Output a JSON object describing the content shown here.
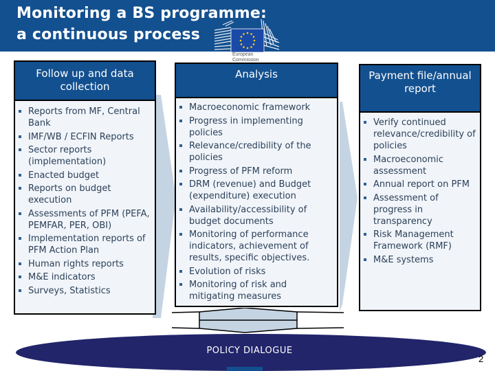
{
  "slide": {
    "title_lines": [
      "Monitoring a BS programme:",
      "a continuous process"
    ],
    "logo_caption": [
      "European",
      "Commission"
    ],
    "page_number": "2"
  },
  "columns": [
    {
      "heading": "Follow up and data collection",
      "items": [
        "Reports from MF, Central Bank",
        "IMF/WB / ECFIN Reports",
        "Sector reports (implementation)",
        "Enacted budget",
        "Reports on budget execution",
        "Assessments of PFM (PEFA, PEMFAR, PER, OBI)",
        "Implementation reports of PFM Action Plan",
        "Human rights reports",
        "M&E indicators",
        "Surveys, Statistics"
      ]
    },
    {
      "heading": "Analysis",
      "items": [
        "Macroeconomic framework",
        "Progress in implementing policies",
        "Relevance/credibility of the policies",
        "Progress of PFM reform",
        "DRM (revenue) and Budget (expenditure) execution",
        "Availability/accessibility of budget documents",
        "Monitoring of performance indicators, achievement of results,  specific objectives.",
        "Evolution of risks",
        "Monitoring of risk and mitigating measures"
      ]
    },
    {
      "heading": "Payment file/annual report",
      "items": [
        "Verify continued relevance/credibility of policies",
        "Macroeconomic assessment",
        "Annual report on PFM",
        "Assessment of progress in transparency",
        "Risk Management Framework (RMF)",
        "M&E systems"
      ]
    }
  ],
  "policy_dialogue": {
    "label": "POLICY DIALOGUE"
  },
  "colors": {
    "header_blue": "#13508f",
    "box_fill": "#f1f5fa",
    "arrow_fill": "#c5d4e3",
    "ellipse_navy": "#22256a",
    "text_dark": "#2b3f57"
  }
}
